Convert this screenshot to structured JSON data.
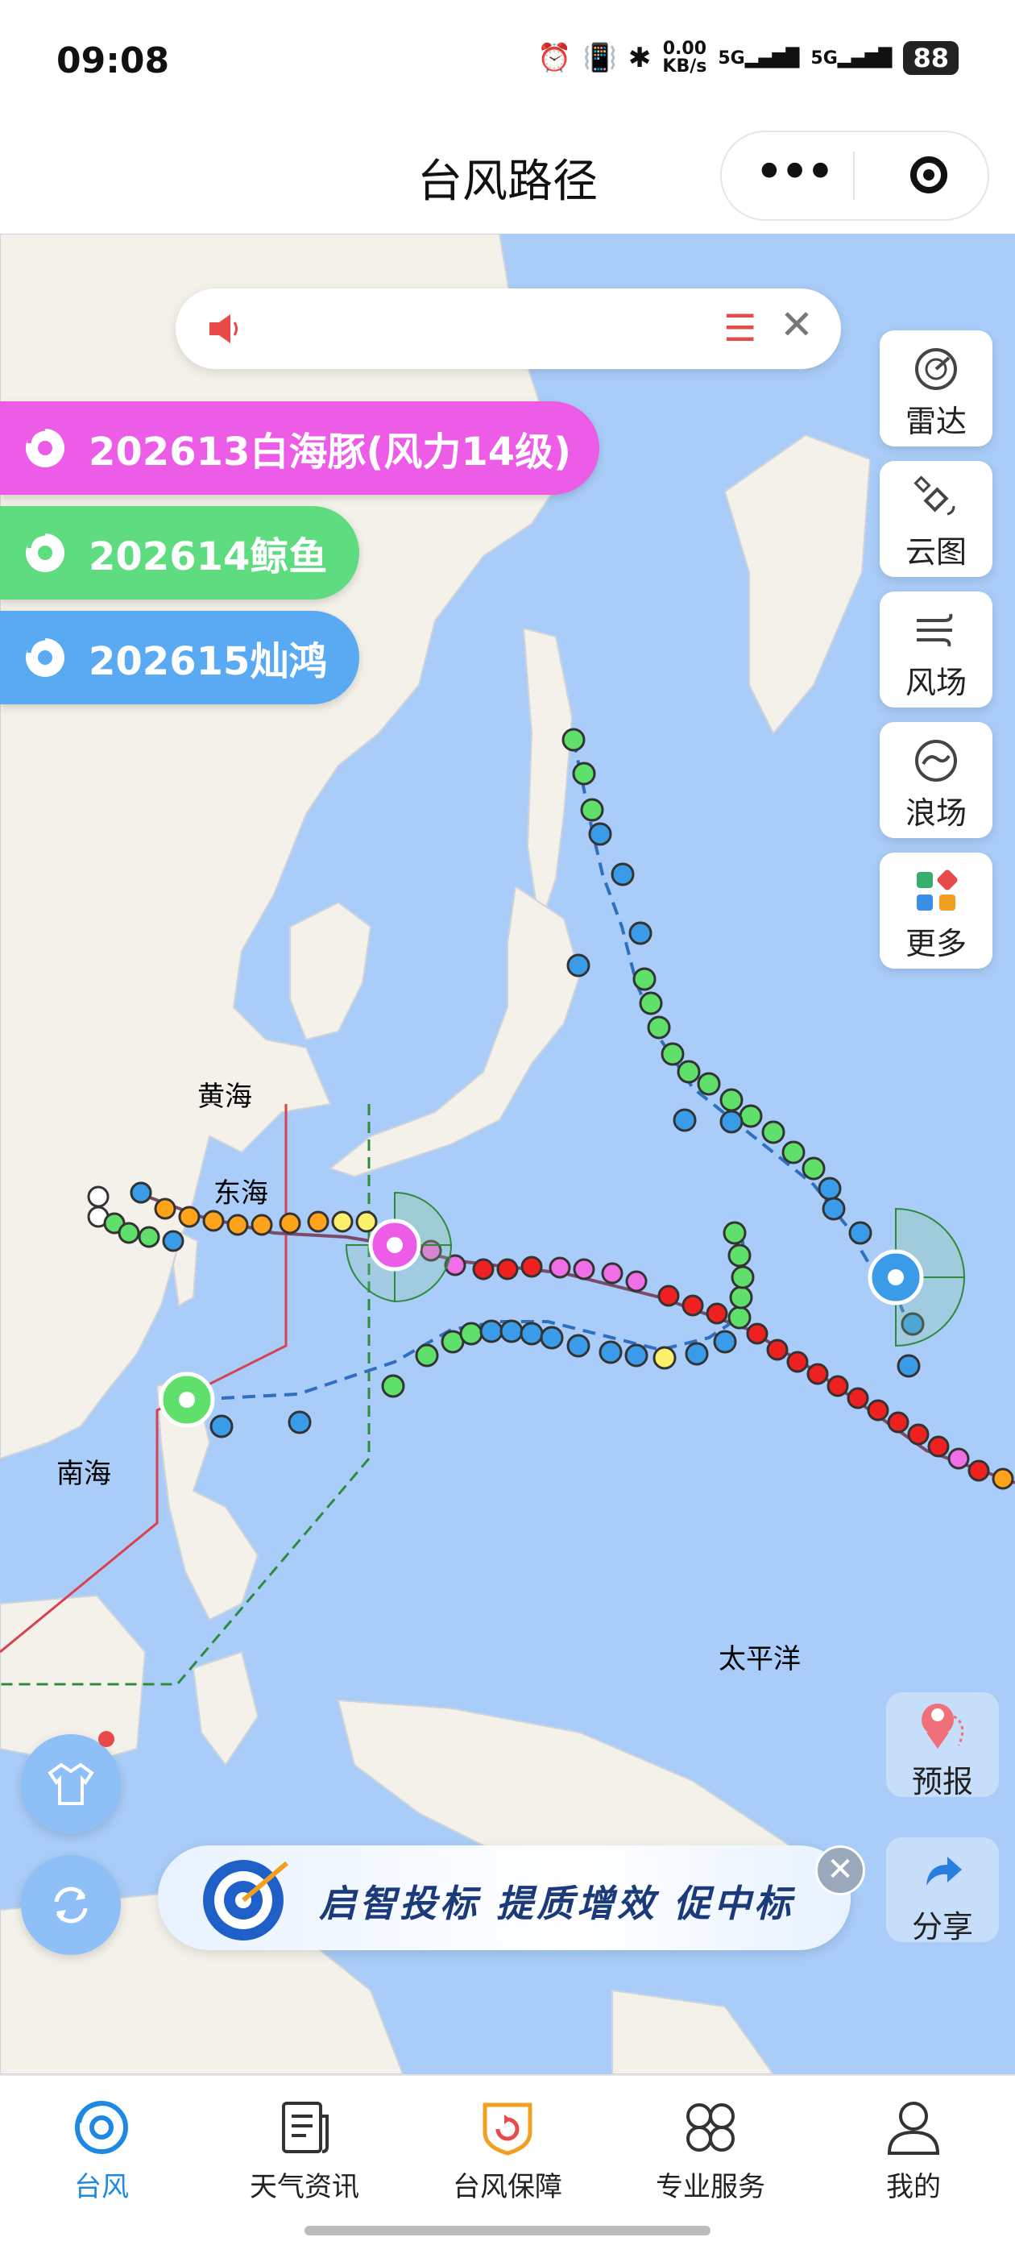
{
  "status_bar": {
    "time": "09:08",
    "net_speed": "0.00",
    "net_unit": "KB/s",
    "signal1": "5G",
    "signal2": "5G",
    "battery": "88"
  },
  "header": {
    "title": "台风路径"
  },
  "notice": {
    "text": ""
  },
  "typhoons": [
    {
      "label": "202613白海豚(风力14级)",
      "color": "#ec5ce6"
    },
    {
      "label": "202614鲸鱼",
      "color": "#5fdc80"
    },
    {
      "label": "202615灿鸿",
      "color": "#5aaaf3"
    }
  ],
  "tools": [
    {
      "label": "雷达",
      "icon": "radar-icon"
    },
    {
      "label": "云图",
      "icon": "satellite-icon"
    },
    {
      "label": "风场",
      "icon": "wind-icon"
    },
    {
      "label": "浪场",
      "icon": "wave-icon"
    },
    {
      "label": "更多",
      "icon": "grid-icon"
    }
  ],
  "map_labels": {
    "yellow_sea": "黄海",
    "east_sea": "东海",
    "south_sea": "南海",
    "pacific": "太平洋"
  },
  "side_buttons": {
    "forecast": "预报",
    "share": "分享"
  },
  "banner": {
    "text": "启智投标 提质增效 促中标"
  },
  "tabs": [
    {
      "label": "台风",
      "icon": "typhoon-icon",
      "active": true
    },
    {
      "label": "天气资讯",
      "icon": "news-icon",
      "active": false
    },
    {
      "label": "台风保障",
      "icon": "shield-icon",
      "active": false
    },
    {
      "label": "专业服务",
      "icon": "services-icon",
      "active": false
    },
    {
      "label": "我的",
      "icon": "profile-icon",
      "active": false
    }
  ],
  "colors": {
    "accent": "#1e88e5",
    "land": "#f4f1ea",
    "sea": "#a9cdf8",
    "warn_line": "#d94050",
    "line_48h": "#2e8b3e"
  }
}
